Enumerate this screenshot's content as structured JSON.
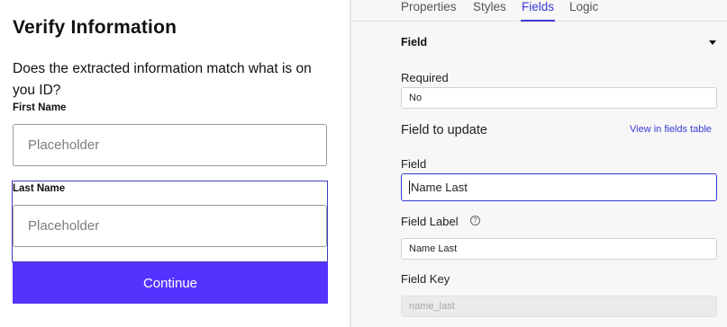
{
  "preview": {
    "title": "Verify Information",
    "question": "Does the extracted information match what is on you ID?",
    "first_name": {
      "label": "First Name",
      "placeholder": "Placeholder"
    },
    "last_name": {
      "label": "Last Name",
      "placeholder": "Placeholder"
    },
    "continue_label": "Continue",
    "accent_color": "#5533ff"
  },
  "panel": {
    "tabs": [
      {
        "label": "Properties",
        "active": false
      },
      {
        "label": "Styles",
        "active": false
      },
      {
        "label": "Fields",
        "active": true
      },
      {
        "label": "Logic",
        "active": false
      }
    ],
    "section_title": "Field",
    "required_label": "Required",
    "required_value": "No",
    "field_to_update_heading": "Field to update",
    "view_fields_link": "View in fields table",
    "field_label": "Field",
    "field_value": "Name Last",
    "field_label_label": "Field Label",
    "field_label_value": "Name Last",
    "field_key_label": "Field Key",
    "field_key_placeholder": "name_last",
    "help_icon": "?",
    "accent_color": "#3a3ad6"
  }
}
